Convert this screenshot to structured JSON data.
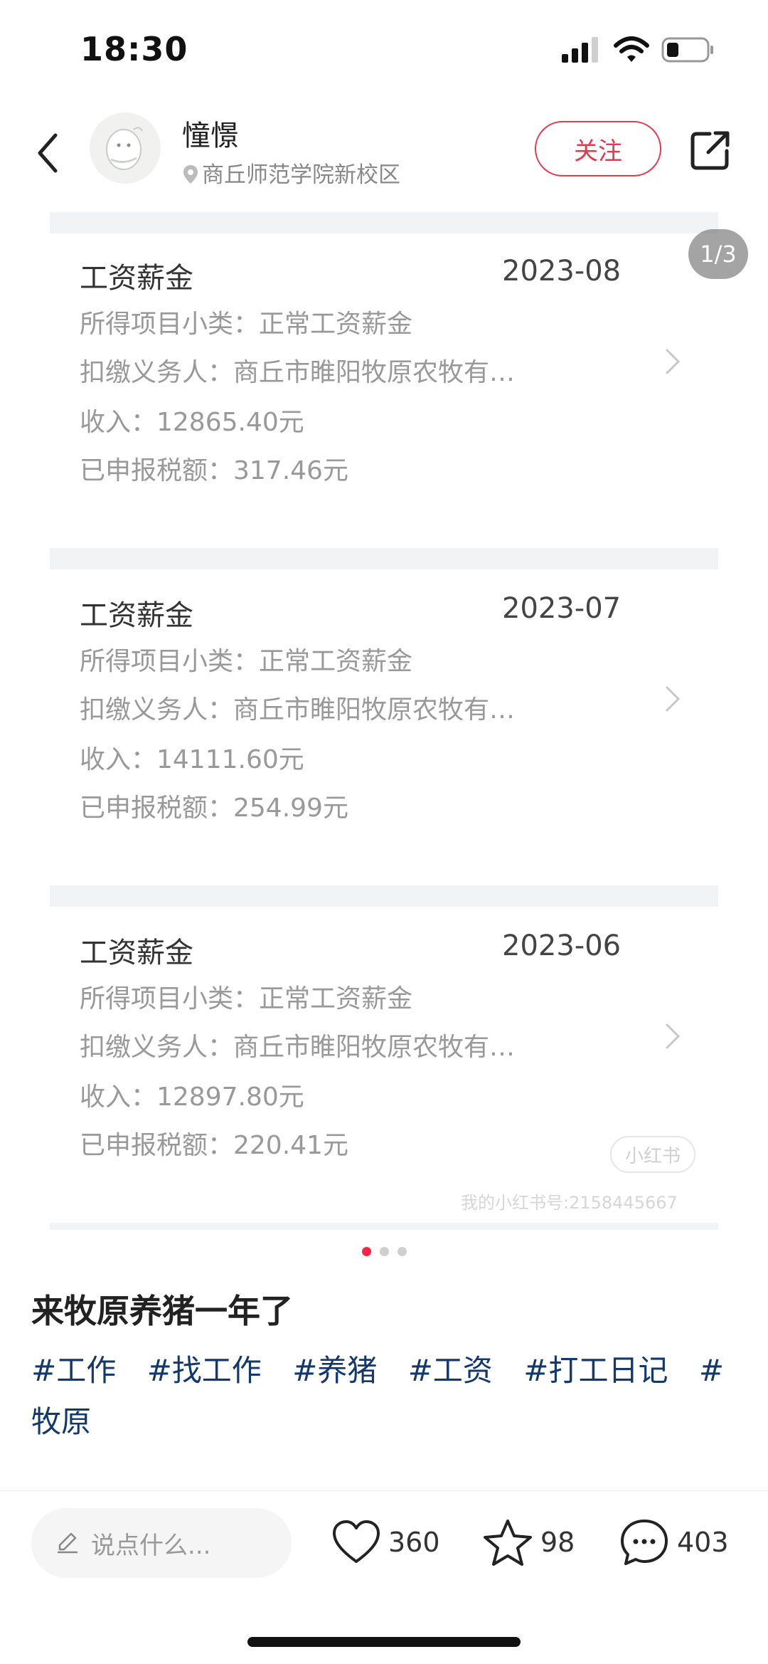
{
  "status_bar": {
    "time": "18:30"
  },
  "header": {
    "username": "憧憬",
    "location": "商丘师范学院新校区",
    "follow_label": "关注"
  },
  "carousel": {
    "page_indicator": "1/3",
    "pages_total": 3,
    "active_page": 1,
    "records": [
      {
        "title": "工资薪金",
        "date": "2023-08",
        "subcategory": "所得项目小类：正常工资薪金",
        "withholder": "扣缴义务人：商丘市睢阳牧原农牧有…",
        "income": "收入：12865.40元",
        "tax": "已申报税额：317.46元"
      },
      {
        "title": "工资薪金",
        "date": "2023-07",
        "subcategory": "所得项目小类：正常工资薪金",
        "withholder": "扣缴义务人：商丘市睢阳牧原农牧有…",
        "income": "收入：14111.60元",
        "tax": "已申报税额：254.99元"
      },
      {
        "title": "工资薪金",
        "date": "2023-06",
        "subcategory": "所得项目小类：正常工资薪金",
        "withholder": "扣缴义务人：商丘市睢阳牧原农牧有…",
        "income": "收入：12897.80元",
        "tax": "已申报税额：220.41元"
      }
    ],
    "watermark_logo": "小红书",
    "watermark_text": "我的小红书号:2158445667"
  },
  "note": {
    "title": "来牧原养猪一年了",
    "tags": [
      "#工作",
      "#找工作",
      "#养猪",
      "#工资",
      "#打工日记",
      "#牧原"
    ]
  },
  "bottom_bar": {
    "comment_placeholder": "说点什么...",
    "likes": "360",
    "collects": "98",
    "comments": "403"
  },
  "colors": {
    "accent": "#ff2442",
    "follow_red": "#e8374e",
    "tag_blue": "#13386c"
  },
  "icons": [
    "signal-icon",
    "wifi-icon",
    "battery-icon",
    "back-icon",
    "location-pin-icon",
    "share-icon",
    "chevron-right-icon",
    "pencil-icon",
    "heart-icon",
    "star-icon",
    "comment-icon"
  ]
}
